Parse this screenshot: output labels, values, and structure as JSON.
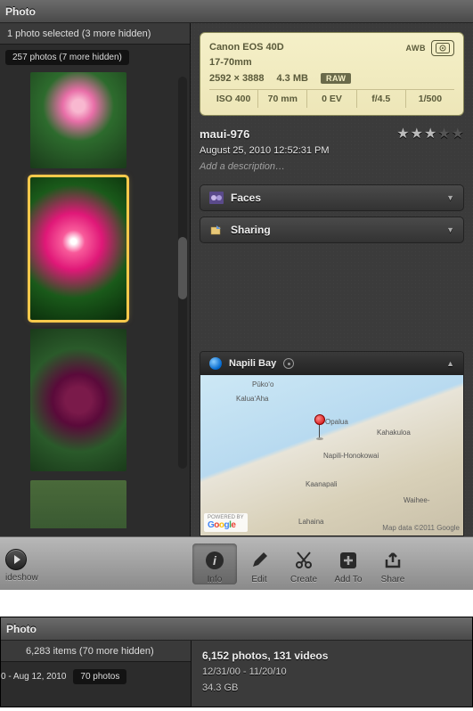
{
  "panel1": {
    "title": "Photo",
    "sidebar": {
      "selection_text": "1 photo selected (3 more hidden)",
      "count_text": "257 photos (7 more hidden)"
    },
    "exif": {
      "camera": "Canon EOS 40D",
      "lens": "17-70mm",
      "dimensions": "2592 × 3888",
      "filesize": "4.3 MB",
      "wb": "AWB",
      "raw": "RAW",
      "cells": [
        "ISO 400",
        "70 mm",
        "0 EV",
        "f/4.5",
        "1/500"
      ]
    },
    "photo": {
      "title": "maui-976",
      "date": "August 25, 2010 12:52:31 PM",
      "desc_placeholder": "Add a description…",
      "rating": 3
    },
    "sections": {
      "faces": "Faces",
      "sharing": "Sharing"
    },
    "map": {
      "location": "Napili Bay",
      "labels": {
        "puko": "Pūko‘o",
        "kalua": "Kalua‘Aha",
        "opalua": "Opalua",
        "kahakuloa": "Kahakuloa",
        "napili": "Napili-Honokowai",
        "kaanapali": "Kaanapali",
        "waihee": "Waihee-",
        "lahaina": "Lahaina"
      },
      "powered": "POWERED BY",
      "copyright": "Map data ©2011 Google"
    },
    "toolbar": {
      "slideshow": "ideshow",
      "info": "Info",
      "edit": "Edit",
      "create": "Create",
      "addto": "Add To",
      "share": "Share"
    }
  },
  "panel2": {
    "title": "Photo",
    "left": {
      "selection_text": "6,283 items (70 more hidden)",
      "date_range": "0 - Aug 12, 2010",
      "count": "70 photos"
    },
    "right": {
      "summary": "6,152 photos, 131 videos",
      "dates": "12/31/00 - 11/20/10",
      "size": "34.3 GB"
    }
  }
}
